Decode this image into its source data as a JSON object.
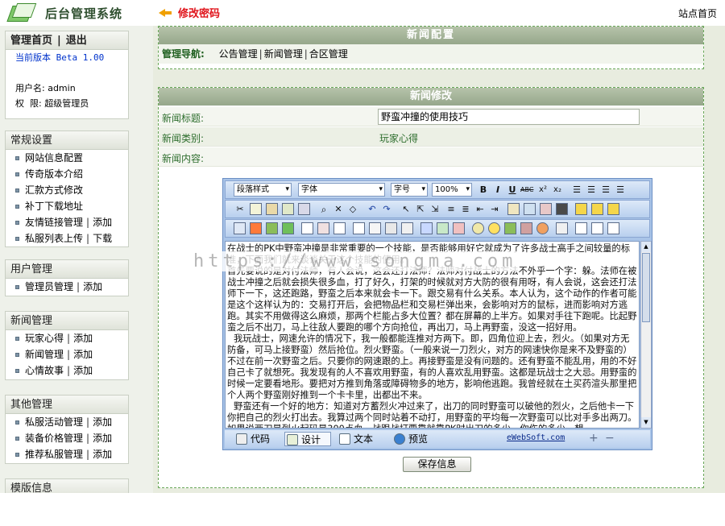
{
  "app": {
    "title": "后台管理系统"
  },
  "header": {
    "page_title": "修改密码",
    "site_home": "站点首页"
  },
  "sidebar": {
    "top": {
      "home": "管理首页",
      "logout": "退出",
      "version": "当前版本 Beta 1.00",
      "username": "用户名: admin",
      "permission": "权  限: 超级管理员"
    },
    "groups": [
      {
        "title": "常规设置",
        "items": [
          {
            "label": "网站信息配置"
          },
          {
            "label": "传奇版本介绍"
          },
          {
            "label": "汇款方式修改"
          },
          {
            "label": "补丁下载地址"
          },
          {
            "label": "友情链接管理",
            "extra": "添加"
          },
          {
            "label": "私服列表上传",
            "extra": "下载"
          }
        ]
      },
      {
        "title": "用户管理",
        "items": [
          {
            "label": "管理员管理",
            "extra": "添加"
          }
        ]
      },
      {
        "title": "新闻管理",
        "items": [
          {
            "label": "玩家心得",
            "extra": "添加"
          },
          {
            "label": "新闻管理",
            "extra": "添加"
          },
          {
            "label": "心情故事",
            "extra": "添加"
          }
        ]
      },
      {
        "title": "其他管理",
        "items": [
          {
            "label": "私服活动管理",
            "extra": "添加"
          },
          {
            "label": "装备价格管理",
            "extra": "添加"
          },
          {
            "label": "推荐私服管理",
            "extra": "添加"
          }
        ]
      },
      {
        "title": "模版信息",
        "items": []
      }
    ]
  },
  "news_config": {
    "heading": "新闻配置",
    "nav_label": "管理导航:",
    "nav_links": [
      "公告管理",
      "新闻管理",
      "合区管理"
    ]
  },
  "news_edit": {
    "heading": "新闻修改",
    "title_label": "新闻标题:",
    "title_value": "野蛮冲撞的使用技巧",
    "category_label": "新闻类别:",
    "category_value": "玩家心得",
    "content_label": "新闻内容:",
    "save_button": "保存信息"
  },
  "editor": {
    "paragraph_style": "段落样式",
    "font": "字体",
    "font_size": "字号",
    "zoom": "100%",
    "content": [
      "在战士的PK中野蛮冲撞是非常重要的一个技能，是否能够用好它就成为了许多战士高手之间较量的标准，下面我们就来谈谈关于这个技能的使用。",
      "首先要说的是对付法师，有人会说，这会还打法师？法师对付战士的方法不外乎一个字：躲。法师在被战士冲撞之后就会损失很多血，打了好久，打架的时候就对方大防的很有用呀，有人会说，这会还打法师下一下，这还跑路，野蛮之后本来就会卡一下。跟交易有什么关系。本人认为，这个动作的作者可能是这个这样认为的：交易打开后，会把物品栏和交易栏弹出来，会影响对方的鼠标，进而影响对方逃跑。其实不用做得这么麻烦，那两个栏能占多大位置？都在屏幕的上半方。如果对手往下跑呢。比起野蛮之后不出刀，马上往敌人要跑的哪个方向抢位，再出刀，马上再野蛮，没这一招好用。",
      "我玩战士，网速允许的情况下，我一般都能连推对方两下。即，四角位迎上去，烈火。（如果对方无防备，可马上接野蛮）然后抢位。烈火野蛮。（一般来说一刀烈火，对方的网速快你是来不及野蛮的）不过在前一次野蛮之后。只要你的网速跟的上。再接野蛮是没有问题的。还有野蛮不能乱用，用的不好自己卡了就想死。我发现有的人不喜欢用野蛮，有的人喜欢乱用野蛮。这都是玩战士之大忌。用野蛮的时候一定要看地形。要把对方推到角落或障碍物多的地方，影响他逃跑。我曾经就在土买药渲头那里把个人两个野蛮刚好推到一个卡卡里，出都出不来。",
      "野蛮还有一个好的地方：知道对方蓄烈火冲过来了，出刀的同时野蛮可以破他的烈火，之后他卡一下你把自己的烈火打出去。我算过两个同时站着不动打，用野蛮的平均每一次野蛮可以比对手多出两刀。如果说两刀是烈火起码是300点血。战跟战打要靠就靠PK时出刀的多少，你伤的多少。想"
    ],
    "modes": [
      "代码",
      "设计",
      "文本",
      "预览"
    ],
    "brand": "eWebSoft.com"
  },
  "watermark": "https://www.songma.com"
}
